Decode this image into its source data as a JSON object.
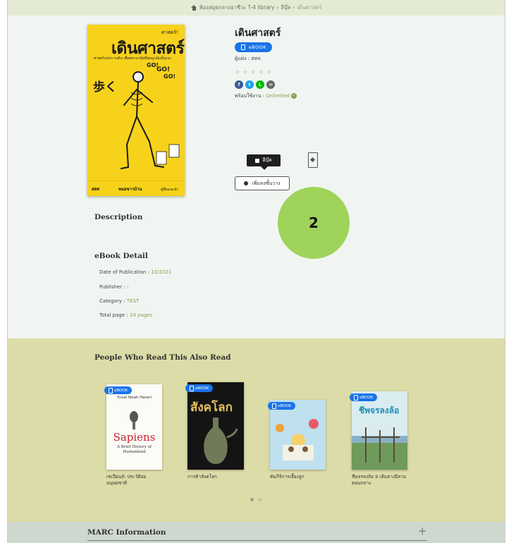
{
  "breadcrumb": {
    "home": "ห้องสมุดกลางอาชีวะ T-4 library",
    "category": "อีบุ๊ค",
    "current": "เดินศาสตร์"
  },
  "book": {
    "title": "เดินศาสตร์",
    "badge": "eBOOK",
    "author": "ผู้แต่ง : สสส.",
    "rating": 0,
    "rating_max": 5,
    "availability_label": "พร้อมใช้งาน : ",
    "availability_value": "Unlimited",
    "cover": {
      "title": "เดินศาสตร์",
      "small": "ศาสตร์!",
      "subtitle": "ศาสตร์แห่งการเดิน เพื่อพลานามัยที่สมบูรณ์แข็งแรง",
      "foot_left": "สสส",
      "foot_mid": "หมอชาวบ้าน",
      "foot_right": "คู่มือแนะนำ"
    }
  },
  "share_icons": [
    "facebook-icon",
    "twitter-icon",
    "line-icon",
    "email-icon"
  ],
  "tooltip": {
    "label": "อีบุ๊ค"
  },
  "buttons": {
    "borrow_label": "เพิ่มลงชั้นวาง"
  },
  "step_marker": "2",
  "sections": {
    "description": "Description",
    "detail": "eBook Detail",
    "reco": "People Who Read This Also Read",
    "marc": "MARC Information"
  },
  "details": [
    {
      "label": "Date of Publication : ",
      "value": "10/2021"
    },
    {
      "label": "Publisher : ",
      "value": "-"
    },
    {
      "label": "Category : ",
      "value": "TEST"
    },
    {
      "label": "Total page : ",
      "value": "24 pages"
    }
  ],
  "recommendations": [
    {
      "title": "เซเปียนส์: ประวัติย่อมนุษยชาติ",
      "badge": "eBOOK",
      "cover_text": "Sapiens",
      "cover_author": "Yuval Noah Harari",
      "cover_sub": "A Brief History of Humankind"
    },
    {
      "title": "การค้าสังคโลก",
      "badge": "eBOOK",
      "cover_text": "สังคโลก"
    },
    {
      "title": "คัมภีร์การเลี้ยงลูก",
      "badge": "eBOOK"
    },
    {
      "title": "ชีพจรลงล้อ 9 เส้นทางอีสานตอนกลาง",
      "badge": "eBOOK",
      "cover_text": "ชีพจรลงล้อ"
    }
  ],
  "colors": {
    "accent": "#1a73e8",
    "olive": "#8a9a55",
    "reco_bg": "#dcdca8",
    "marker": "#9fd35a"
  }
}
